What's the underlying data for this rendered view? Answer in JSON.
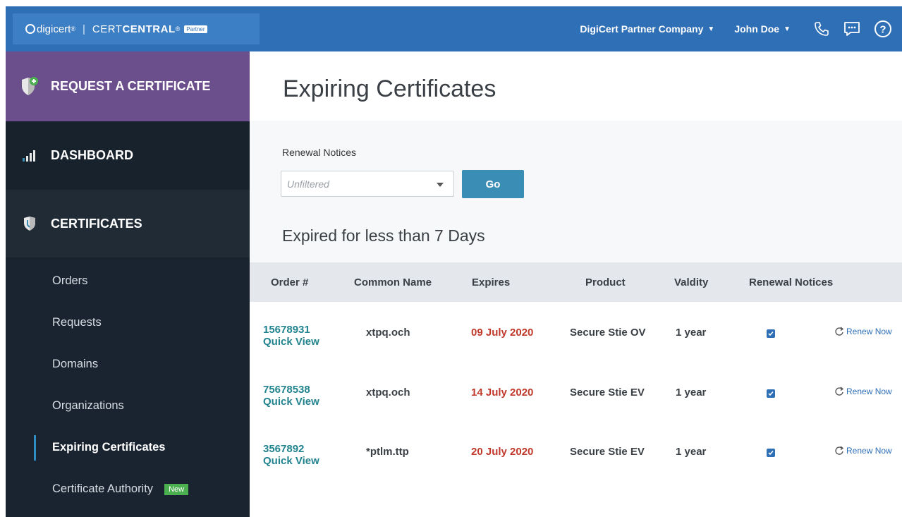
{
  "header": {
    "brand": "digicert",
    "brand_reg": "®",
    "product_prefix": "CERT",
    "product_main": "CENTRAL",
    "product_reg": "®",
    "partner_badge": "Partner",
    "separator": "|",
    "company_menu": "DigiCert Partner Company",
    "user_menu": "John Doe",
    "icons": [
      "phone-icon",
      "chat-icon",
      "help-icon"
    ]
  },
  "sidebar": {
    "request": "REQUEST A CERTIFICATE",
    "dashboard": "DASHBOARD",
    "certificates": "CERTIFICATES",
    "items": [
      {
        "label": "Orders"
      },
      {
        "label": "Requests"
      },
      {
        "label": "Domains"
      },
      {
        "label": "Organizations"
      },
      {
        "label": "Expiring Certificates"
      },
      {
        "label": "Certificate Authority",
        "badge": "New"
      }
    ]
  },
  "main": {
    "title": "Expiring Certificates",
    "filter": {
      "label": "Renewal Notices",
      "select_value": "Unfiltered",
      "go_label": "Go"
    },
    "section_title": "Expired for less than 7 Days",
    "table": {
      "columns": [
        "Order #",
        "Common Name",
        "Expires",
        "Product",
        "Valdity",
        "Renewal Notices"
      ],
      "rows": [
        {
          "order": "15678931",
          "quick_view": "Quick View",
          "common_name": "xtpq.och",
          "expires": "09 July 2020",
          "product": "Secure Stie OV",
          "validity": "1 year",
          "renewal_checked": true,
          "action": "Renew Now"
        },
        {
          "order": "75678538",
          "quick_view": "Quick View",
          "common_name": "xtpq.och",
          "expires": "14 July 2020",
          "product": "Secure Stie EV",
          "validity": "1 year",
          "renewal_checked": true,
          "action": "Renew Now"
        },
        {
          "order": "3567892",
          "quick_view": "Quick View",
          "common_name": "*ptlm.ttp",
          "expires": "20 July 2020",
          "product": "Secure Stie EV",
          "validity": "1 year",
          "renewal_checked": true,
          "action": "Renew Now"
        }
      ]
    }
  },
  "colors": {
    "topbar": "#2f6fb5",
    "request_bg": "#6b4e8c",
    "sidebar_bg": "#1a2430",
    "link": "#21838e",
    "expired": "#c0392b",
    "go_button": "#3a8db4",
    "new_badge": "#4caf50"
  }
}
